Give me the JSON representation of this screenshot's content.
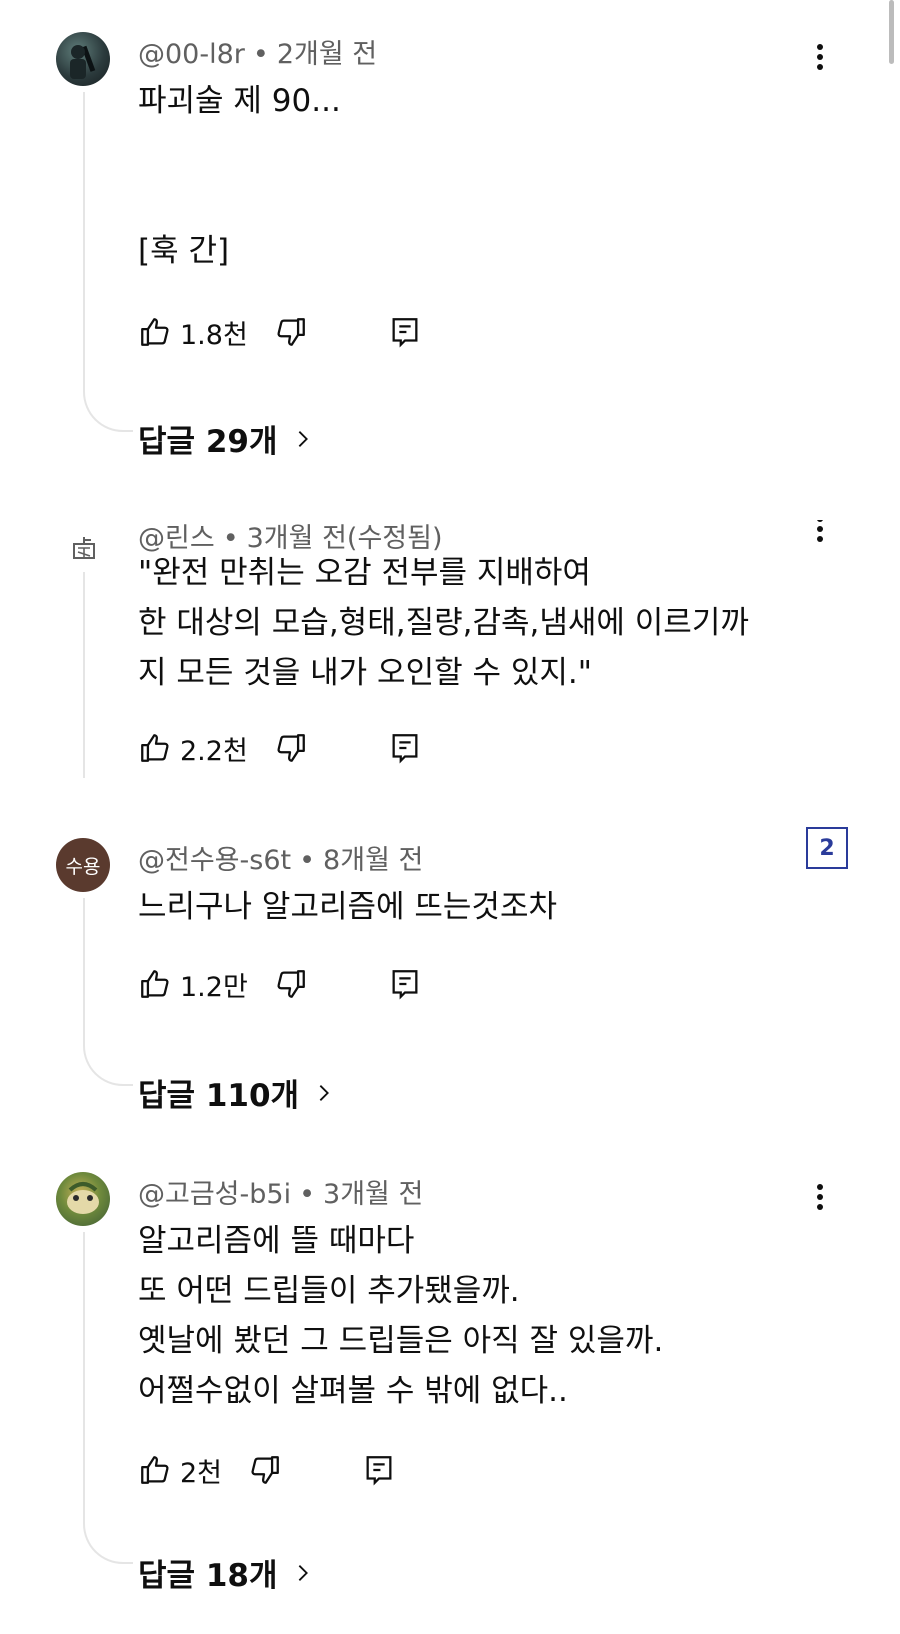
{
  "comments": [
    {
      "author": "@00-l8r",
      "time": "2개월 전",
      "text": "파괴술 제 90...\n\n\n[훅 간]",
      "likes": "1.8천",
      "replies": "답글 29개"
    },
    {
      "author": "@린스",
      "time": "3개월 전(수정됨)",
      "text": "\"완전 만취는 오감 전부를 지배하여\n한 대상의 모습,형태,질량,감촉,냄새에 이르기까\n지 모든 것을 내가 오인할 수 있지.\"",
      "likes": "2.2천"
    },
    {
      "author": "@전수용-s6t",
      "avatar_text": "수용",
      "time": "8개월 전",
      "text": "느리구나 알고리즘에 뜨는것조차",
      "likes": "1.2만",
      "replies": "답글 110개"
    },
    {
      "author": "@고금성-b5i",
      "time": "3개월 전",
      "text": "알고리즘에 뜰 때마다\n또 어떤 드립들이 추가됐을까.\n옛날에 봤던 그 드립들은 아직 잘 있을까.\n어쩔수없이 살펴볼 수 밖에 없다..",
      "likes": "2천",
      "replies": "답글 18개"
    }
  ],
  "page_badge": "2",
  "icons": [
    "thumb-up-icon",
    "thumb-down-icon",
    "reply-icon",
    "more-vert-icon",
    "chevron-right-icon"
  ]
}
